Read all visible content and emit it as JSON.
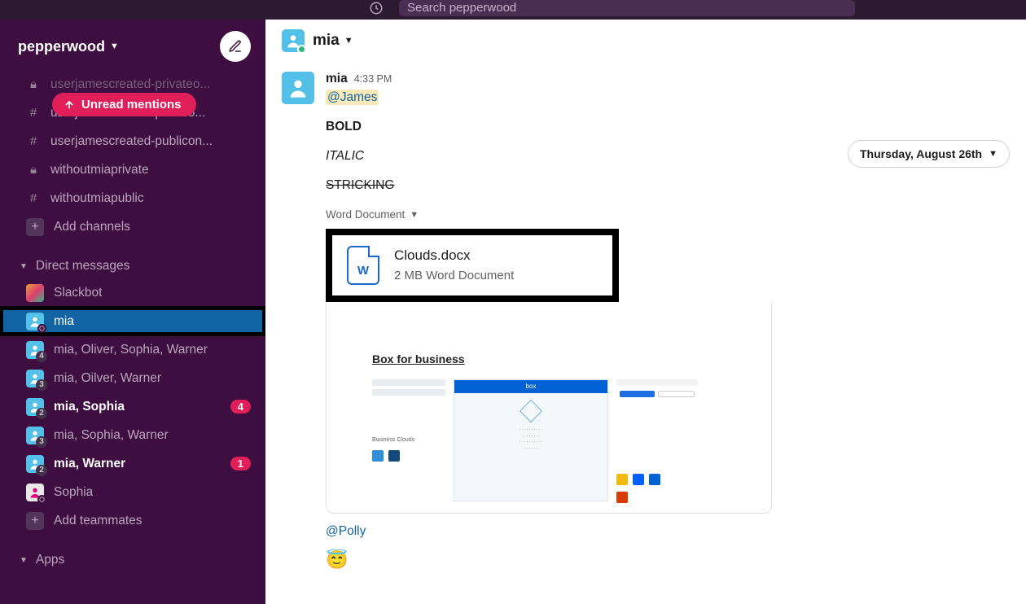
{
  "search": {
    "placeholder": "Search pepperwood"
  },
  "workspace_name": "pepperwood",
  "unread_pill": "Unread mentions",
  "channels": [
    {
      "icon": "lock",
      "name": "userjamescreated-privateo...",
      "partial": true
    },
    {
      "icon": "hash",
      "name": "userjamescreated-public5..."
    },
    {
      "icon": "hash",
      "name": "userjamescreated-publicon..."
    },
    {
      "icon": "lock",
      "name": "withoutmiaprivate"
    },
    {
      "icon": "hash",
      "name": "withoutmiapublic"
    }
  ],
  "add_channels": "Add channels",
  "dm_header": "Direct messages",
  "dms": [
    {
      "name": "Slackbot",
      "avatar": "slackbot"
    },
    {
      "name": "mia",
      "active": true,
      "avatar": "user",
      "highlighted": true
    },
    {
      "name": "mia, Oliver, Sophia, Warner",
      "count": 4,
      "avatar": "group"
    },
    {
      "name": "mia, Oilver, Warner",
      "count": 3,
      "avatar": "group"
    },
    {
      "name": "mia, Sophia",
      "count": 2,
      "avatar": "group",
      "bold": true,
      "badge": 4
    },
    {
      "name": "mia, Sophia, Warner",
      "count": 3,
      "avatar": "group"
    },
    {
      "name": "mia, Warner",
      "count": 2,
      "avatar": "group",
      "bold": true,
      "badge": 1
    },
    {
      "name": "Sophia",
      "avatar": "sophia"
    }
  ],
  "add_teammates": "Add teammates",
  "apps_header": "Apps",
  "conversation": {
    "title": "mia",
    "date_label": "Thursday, August 26th"
  },
  "message": {
    "author": "mia",
    "time": "4:33 PM",
    "mention1": "@James",
    "bold": "BOLD",
    "italic": "ITALIC",
    "strike": "STRICKING",
    "file_type_label": "Word Document",
    "file": {
      "name": "Clouds.docx",
      "meta": "2 MB Word Document",
      "icon_letter": "W"
    },
    "preview_title": "Box for business",
    "mention2": "@Polly",
    "emoji": "😇"
  }
}
